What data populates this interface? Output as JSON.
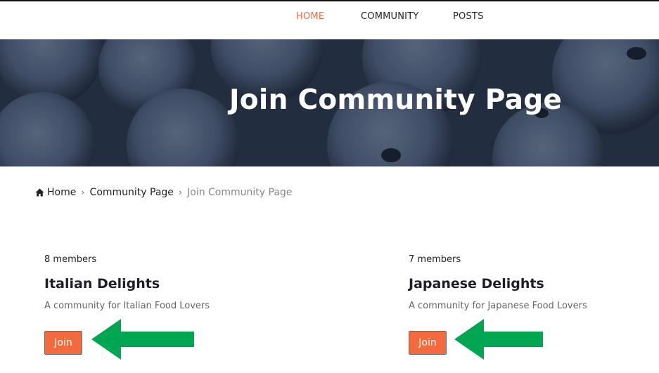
{
  "nav": {
    "items": [
      {
        "label": "HOME",
        "active": true
      },
      {
        "label": "COMMUNITY",
        "active": false
      },
      {
        "label": "POSTS",
        "active": false
      }
    ]
  },
  "hero": {
    "title": "Join Community Page"
  },
  "breadcrumb": {
    "home": "Home",
    "parent": "Community Page",
    "current": "Join Community Page",
    "separator": "›"
  },
  "communities": [
    {
      "members": "8 members",
      "name": "Italian Delights",
      "description": "A community for Italian Food Lovers",
      "button": "Join"
    },
    {
      "members": "7 members",
      "name": "Japanese Delights",
      "description": "A community for Japanese Food Lovers",
      "button": "Join"
    }
  ],
  "colors": {
    "accent": "#f26a3d",
    "annotation_arrow": "#00a651"
  },
  "icons": {
    "breadcrumb_home": "home-icon",
    "annotation": "arrow-left-icon"
  }
}
